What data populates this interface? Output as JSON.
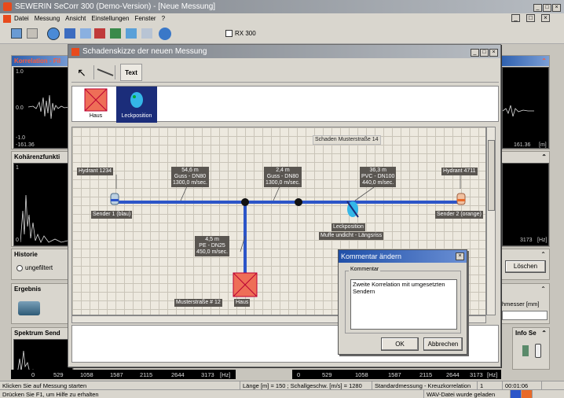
{
  "app": {
    "title": "SEWERIN SeCorr 300 (Demo-Version) - [Neue Messung]",
    "menu": [
      "Datei",
      "Messung",
      "Ansicht",
      "Einstellungen",
      "Fenster",
      "?"
    ],
    "rx_label": "RX 300"
  },
  "left_panels": {
    "korrelation": "Korrelation - Fil",
    "korr_y_top": "1.0",
    "korr_y_mid": "0.0",
    "korr_y_bot": "-1.0",
    "korr_x_left": "-161.36",
    "korr_x_right": "161.36",
    "korr_x_unit": "[m]",
    "kohaerenz": "Kohärenzfunkti",
    "koh_y_top": "1",
    "koh_y_bot": "0",
    "koh_x_right": "3173",
    "koh_x_unit": "[Hz]",
    "historie": "Historie",
    "historie_option": "ungefiltert",
    "loeschen": "Löschen",
    "ergebnis": "Ergebnis",
    "durchmesser": "hmesser [mm]",
    "spektrum": "Spektrum Send",
    "info": "Info Se",
    "spek_ticks_left": [
      "0",
      "529",
      "1058",
      "1587",
      "2115",
      "2644",
      "3173",
      "[Hz]"
    ],
    "spek_ticks_right": [
      "0",
      "529",
      "1058",
      "1587",
      "2115",
      "2644",
      "3173",
      "[Hz]"
    ]
  },
  "dialog": {
    "title": "Schadenskizze der neuen Messung",
    "tool_text": "Text",
    "palette": [
      {
        "label": "Haus"
      },
      {
        "label": "Leckposition"
      }
    ],
    "header_note": "Schaden Musterstraße 14",
    "labels": {
      "hydrant_left": "Hydrant 1234",
      "hydrant_right": "Hydrant 4711",
      "sender1": "Sender 1 (blau)",
      "sender2": "Sender 2 (orange)",
      "seg1": [
        "54,6 m",
        "Guss - DN80",
        "1300,0 m/sec."
      ],
      "seg2": [
        "2,4 m",
        "Guss - DN80",
        "1300,0 m/sec."
      ],
      "seg3": [
        "36,3 m",
        "PVC - DN100",
        "440,0 m/sec."
      ],
      "seg4": [
        "4,5 m",
        "PE - DN25",
        "450,0 m/sec."
      ],
      "leck": "Leckposition",
      "muffe": "Muffe undicht - Längsriss",
      "muster": "Musterstraße # 12",
      "haus": "Haus"
    }
  },
  "comment_dialog": {
    "title": "Kommentar ändern",
    "group": "Kommentar",
    "text_line1": "Zweite Korrelation mit umgesetzten",
    "text_line2": "Sendern",
    "ok": "OK",
    "cancel": "Abbrechen"
  },
  "status": {
    "hint": "Klicken Sie auf Messung starten",
    "params": "Länge [m] = 150 ; Schallgeschw. [m/s] = 1280",
    "mode": "Standardmessung - Kreuzkorrelation",
    "num": "1",
    "time": "00:01:06",
    "help": "Drücken Sie F1, um Hilfe zu erhalten",
    "wav": "WAV-Datei wurde geladen"
  }
}
